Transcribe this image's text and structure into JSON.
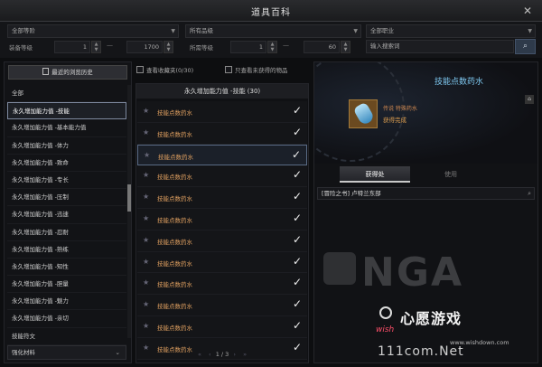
{
  "window": {
    "title": "道具百科",
    "close_label": "✕"
  },
  "filters": {
    "rank_select": "全部等阶",
    "grade_select": "所有品级",
    "class_select": "全部职业",
    "equip_level_label": "装备等级",
    "equip_level_min": "1",
    "equip_level_max": "1700",
    "req_level_label": "所需等级",
    "req_level_min": "1",
    "req_level_max": "60",
    "range_sep": "—",
    "search_placeholder": "输入搜索词",
    "search_icon": "search-icon"
  },
  "sidebar": {
    "history_button": "最近的浏览历史",
    "categories": [
      "全部",
      "永久增加能力值 -技能",
      "永久增加能力值 -基本能力值",
      "永久增加能力值 -体力",
      "永久增加能力值 -致命",
      "永久增加能力值 -专长",
      "永久增加能力值 -压制",
      "永久增加能力值 -迅速",
      "永久增加能力值 -忍耐",
      "永久增加能力值 -熟练",
      "永久增加能力值 -知性",
      "永久增加能力值 -胆量",
      "永久增加能力值 -魅力",
      "永久增加能力值 -亲切",
      "技能符文"
    ],
    "selected_index": 1,
    "bottom_select": "强化材料"
  },
  "list_options": {
    "favorites_label": "查看收藏夹(0/30)",
    "unobtained_label": "只查看未获得的物品"
  },
  "item_list": {
    "header": "永久增加能力值 -技能 (30)",
    "items": [
      "技能点数药水",
      "技能点数药水",
      "技能点数药水",
      "技能点数药水",
      "技能点数药水",
      "技能点数药水",
      "技能点数药水",
      "技能点数药水",
      "技能点数药水",
      "技能点数药水",
      "技能点数药水",
      "技能点数药水"
    ],
    "active_index": 2,
    "page": "1 / 3"
  },
  "detail": {
    "name": "技能点数药水",
    "grade_text": "传说 特殊药水",
    "status_text": "获得完成",
    "tab_obtain": "获得处",
    "tab_use": "使用",
    "source_text": "[冒险之书] 卢特兰东部",
    "watermark": "NGA",
    "site_name": "心愿游戏",
    "site_wish": "wish",
    "site_url": "www.wishdown.com",
    "site_big": "111com.Net"
  },
  "colors": {
    "item_name": "#e0a060",
    "detail_title": "#7ec8f0",
    "accent_border": "#5a6b85"
  }
}
